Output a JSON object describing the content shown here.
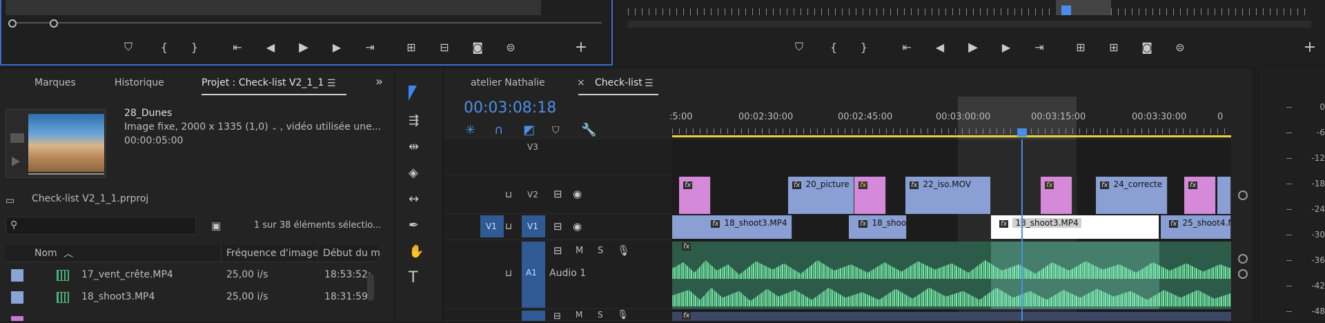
{
  "project_panel": {
    "tabs": [
      {
        "label": "Marques",
        "active": false
      },
      {
        "label": "Historique",
        "active": false
      },
      {
        "label": "Projet : Check-list V2_1_1",
        "active": true
      }
    ],
    "overflow_icon": "double-chevron-right-icon",
    "preview": {
      "name": "28_Dunes",
      "info": "Image fixe, 2000 x 1335 (1,0)",
      "usage": ", vidéo utilisée une...",
      "duration": "00:00:05:00"
    },
    "project_file": "Check-list V2_1_1.prproj",
    "search_placeholder": "",
    "selection_count": "1 sur 38 éléments sélectio...",
    "columns": [
      "Nom",
      "Fréquence d'image",
      "Début du m"
    ],
    "rows": [
      {
        "name": "17_vent_crête.MP4",
        "fps": "25,00 i/s",
        "start": "18:53:52:"
      },
      {
        "name": "18_shoot3.MP4",
        "fps": "25,00 i/s",
        "start": "18:31:59:"
      }
    ]
  },
  "timeline": {
    "tabs": [
      {
        "label": "atelier Nathalie",
        "active": false
      },
      {
        "label": "Check-list",
        "active": true
      }
    ],
    "timecode": "00:03:08:18",
    "ruler_labels": [
      ":5:00",
      "00:02:30:00",
      "00:02:45:00",
      "00:03:00:00",
      "00:03:15:00",
      "00:03:30:00",
      "0"
    ],
    "tracks": {
      "v3": "V3",
      "v2": "V2",
      "v1_src": "V1",
      "v1": "V1",
      "a1": "A1",
      "a1_name": "Audio 1",
      "mute": "M",
      "solo": "S"
    },
    "clips_v2": [
      "20_picture",
      "22_iso.MOV",
      "24_correcte"
    ],
    "clips_v1": [
      "18_shoot3.MP4",
      "18_shoo",
      "18_shoot3.MP4",
      "25_shoot4.M"
    ],
    "fx_label": "fx"
  },
  "meter": {
    "labels": [
      "0",
      "-6",
      "-12",
      "-18",
      "-24",
      "-30",
      "-36",
      "-42",
      "-48"
    ]
  },
  "colors": {
    "timecode": "#4d8fe6",
    "clip_blue": "#8aa0d4",
    "clip_pink": "#d48ad8",
    "audio_green": "#55b07a",
    "playhead": "#4a8de8",
    "work_area": "#e6d43a"
  }
}
